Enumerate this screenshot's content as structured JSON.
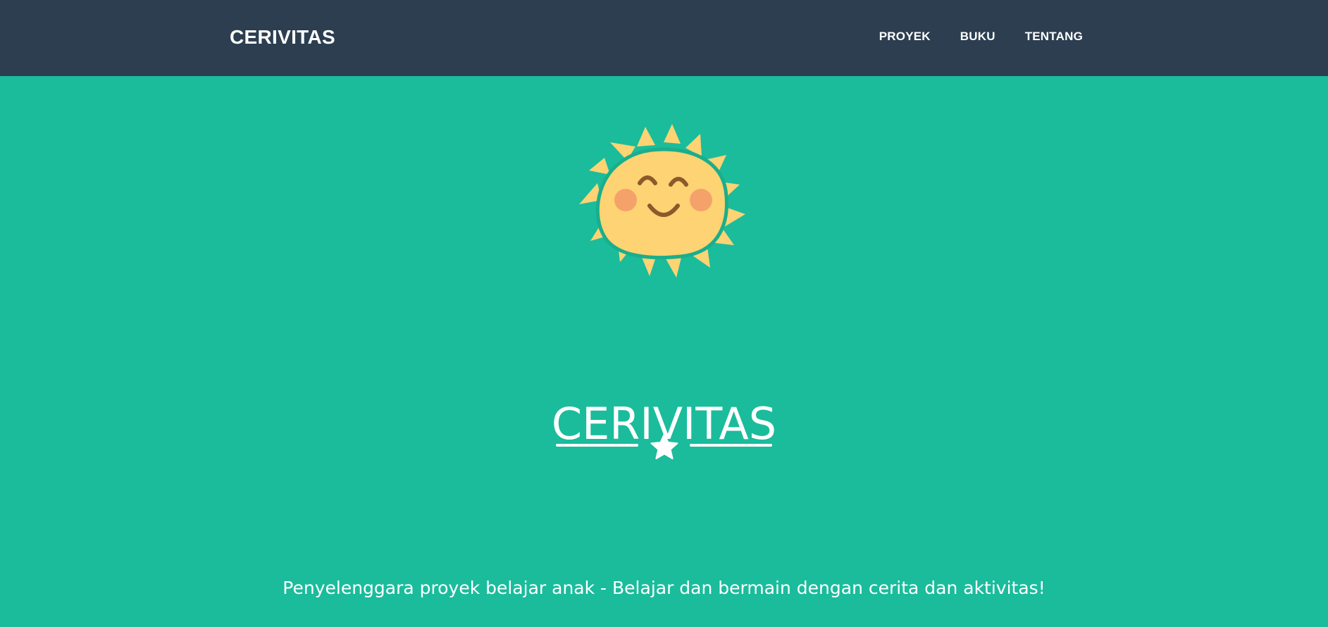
{
  "navbar": {
    "brand": "CERIVITAS",
    "links": [
      {
        "label": "PROYEK"
      },
      {
        "label": "BUKU"
      },
      {
        "label": "TENTANG"
      }
    ]
  },
  "masthead": {
    "avatar_icon": "smiling-sun-icon",
    "title": "CERIVITAS",
    "divider_icon": "star-icon",
    "subtitle": "Penyelenggara proyek belajar anak - Belajar dan bermain dengan cerita dan aktivitas!"
  },
  "colors": {
    "navbar_bg": "#2c3e50",
    "hero_bg": "#1abc9c",
    "sun_body": "#fdd373",
    "sun_rays": "#fdd373",
    "cheeks": "#f5a26a",
    "face_lines": "#8a5a2b",
    "text": "#ffffff"
  }
}
